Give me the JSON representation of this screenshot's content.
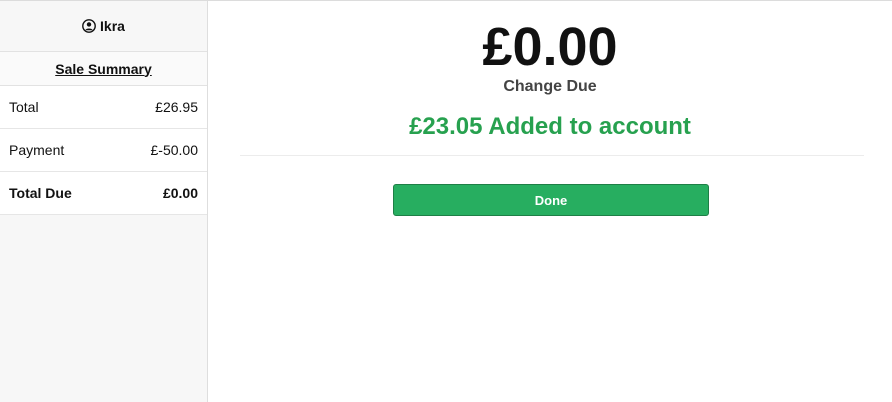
{
  "user": {
    "name": "Ikra",
    "icon": "user-circle-icon"
  },
  "summary": {
    "title": "Sale Summary",
    "rows": [
      {
        "label": "Total",
        "value": "£26.95"
      },
      {
        "label": "Payment",
        "value": "£-50.00"
      },
      {
        "label": "Total Due",
        "value": "£0.00"
      }
    ]
  },
  "main": {
    "change_amount": "£0.00",
    "change_label": "Change Due",
    "added_message": "£23.05 Added to account",
    "done_label": "Done"
  },
  "colors": {
    "accent_green": "#27ae60",
    "message_green": "#27a14f"
  }
}
